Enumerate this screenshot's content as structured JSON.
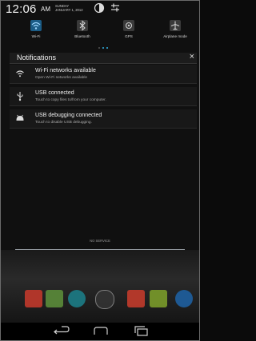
{
  "status": {
    "time": "12:06",
    "ampm": "AM",
    "day": "SUNDAY",
    "date": "JANUARY 1, 2012"
  },
  "quick_settings": [
    {
      "label": "Wi-Fi",
      "icon": "wifi-icon",
      "on": true
    },
    {
      "label": "Bluetooth",
      "icon": "bluetooth-icon",
      "on": false
    },
    {
      "label": "GPS",
      "icon": "gps-icon",
      "on": false
    },
    {
      "label": "Airplane mode",
      "icon": "airplane-icon",
      "on": false
    }
  ],
  "notifications_panel": {
    "title": "Notifications",
    "close": "×"
  },
  "notifications": [
    {
      "title": "Wi-Fi networks available",
      "subtitle": "Open Wi-Fi networks available",
      "icon": "wifi-icon"
    },
    {
      "title": "USB connected",
      "subtitle": "Touch to copy files to/from your computer.",
      "icon": "usb-icon"
    },
    {
      "title": "USB debugging connected",
      "subtitle": "Touch to disable USB debugging.",
      "icon": "android-debug-icon"
    }
  ],
  "carrier": "NO SERVICE",
  "colors": {
    "accent": "#33b5e5",
    "tile_on": "#1b5c86"
  }
}
